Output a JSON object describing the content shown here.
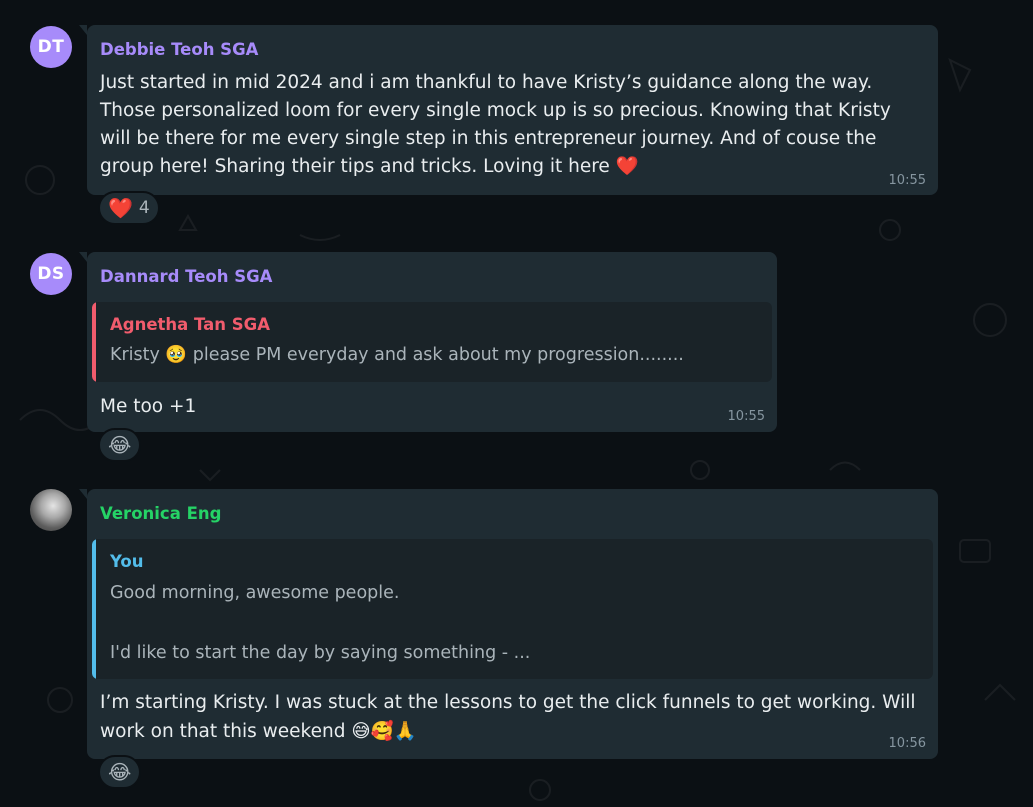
{
  "colors": {
    "background": "#0b1014",
    "bubble": "#1f2c33",
    "quote_bg": "#1a2328",
    "name_purple": "#a78bfa",
    "name_red": "#f15c6d",
    "name_green": "#25d366",
    "name_blue": "#53bdeb",
    "time_gray": "#8696a0"
  },
  "messages": [
    {
      "avatar": "DT",
      "sender": "Debbie Teoh SGA",
      "line1": "Just started in mid 2024 and i am thankful to have Kristy’s guidance along the way.",
      "line2": "Those personalized loom for every single mock up is so precious. Knowing that Kristy",
      "line3": "will be there for me every single step in this entrepreneur journey. And of couse the",
      "line4": "group here! Sharing their tips and tricks. Loving it here ❤️",
      "time": "10:55",
      "reaction_emoji": "❤️",
      "reaction_count": "4"
    },
    {
      "avatar": "DS",
      "sender": "Dannard Teoh SGA",
      "quote_name": "Agnetha Tan SGA",
      "quote_text": "Kristy 🥹 please PM everyday and ask about my progression........",
      "text": "Me too +1",
      "time": "10:55",
      "reaction_emoji": "😂"
    },
    {
      "avatar_icon": "profile-photo",
      "sender": "Veronica Eng",
      "quote_name": "You",
      "quote_line1": "Good morning, awesome people.",
      "quote_line2": "I'd like to start the day by saying something - ...",
      "line1": "I’m starting Kristy. I was stuck at the lessons to get the click funnels to get working. Will",
      "line2": "work on that this weekend 😅🥰🙏",
      "time": "10:56",
      "reaction_emoji": "😂"
    }
  ]
}
